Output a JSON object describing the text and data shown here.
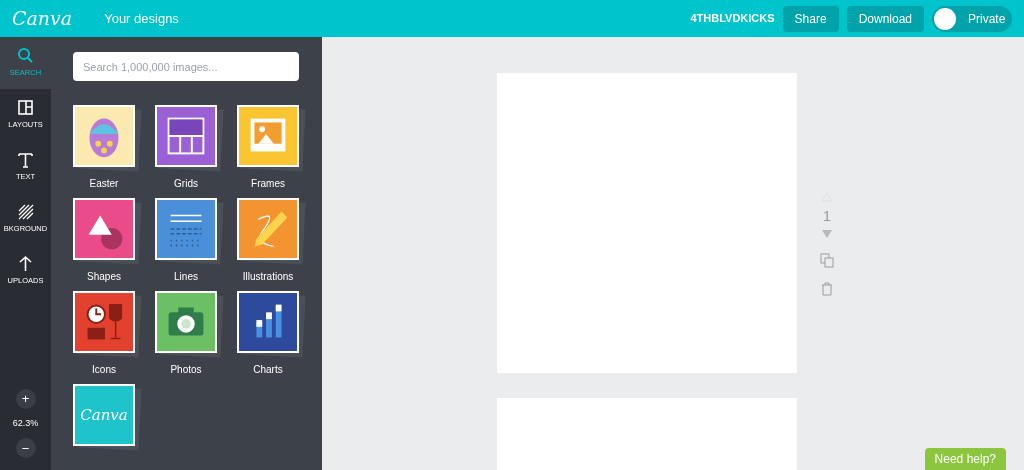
{
  "header": {
    "logo": "Canva",
    "nav_link": "Your designs",
    "team": "4THBLVDKICKS",
    "buttons": [
      "Share",
      "Download"
    ],
    "privacy_toggle": {
      "label": "Private",
      "on": false
    }
  },
  "sidebar": {
    "items": [
      {
        "kind": "search",
        "label": "SEARCH",
        "selected": true
      },
      {
        "kind": "layouts",
        "label": "LAYOUTS",
        "selected": false
      },
      {
        "kind": "text",
        "label": "TEXT",
        "selected": false
      },
      {
        "kind": "background",
        "label": "BKGROUND",
        "selected": false
      },
      {
        "kind": "uploads",
        "label": "UPLOADS",
        "selected": false
      }
    ],
    "zoom": {
      "in": "+",
      "level": "62.3%",
      "out": "−"
    }
  },
  "panel": {
    "search": {
      "placeholder": "Search 1,000,000 images..."
    },
    "tiles": [
      {
        "kind": "easter",
        "label": "Easter",
        "color": "#fbe9b0"
      },
      {
        "kind": "grids",
        "label": "Grids",
        "color": "#9b5fd6"
      },
      {
        "kind": "frames",
        "label": "Frames",
        "color": "#fbc531"
      },
      {
        "kind": "shapes",
        "label": "Shapes",
        "color": "#e94c89"
      },
      {
        "kind": "lines",
        "label": "Lines",
        "color": "#4a90d9"
      },
      {
        "kind": "illustrations",
        "label": "Illustrations",
        "color": "#f39430"
      },
      {
        "kind": "icons",
        "label": "Icons",
        "color": "#e2412f"
      },
      {
        "kind": "photos",
        "label": "Photos",
        "color": "#6cc063"
      },
      {
        "kind": "charts",
        "label": "Charts",
        "color": "#2d4a9c"
      },
      {
        "kind": "logo",
        "text": "Canva",
        "color": "#1ec3cc"
      }
    ]
  },
  "canvas": {
    "page_number": "1"
  },
  "help_button": "Need help?"
}
